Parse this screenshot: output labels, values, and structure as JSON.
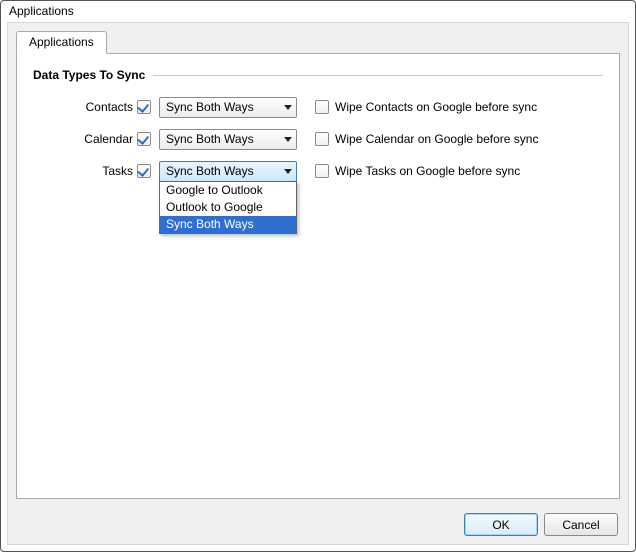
{
  "window": {
    "title": "Applications"
  },
  "tabs": {
    "applications": "Applications"
  },
  "section": {
    "title": "Data Types To Sync"
  },
  "rows": {
    "contacts": {
      "label": "Contacts",
      "mode": "Sync Both Ways",
      "wipe": "Wipe Contacts on Google before sync"
    },
    "calendar": {
      "label": "Calendar",
      "mode": "Sync Both Ways",
      "wipe": "Wipe Calendar on Google before sync"
    },
    "tasks": {
      "label": "Tasks",
      "mode": "Sync Both Ways",
      "wipe": "Wipe Tasks on Google before sync"
    }
  },
  "dropdown": {
    "opt0": "Google to Outlook",
    "opt1": "Outlook to Google",
    "opt2": "Sync Both Ways"
  },
  "buttons": {
    "ok": "OK",
    "cancel": "Cancel"
  }
}
